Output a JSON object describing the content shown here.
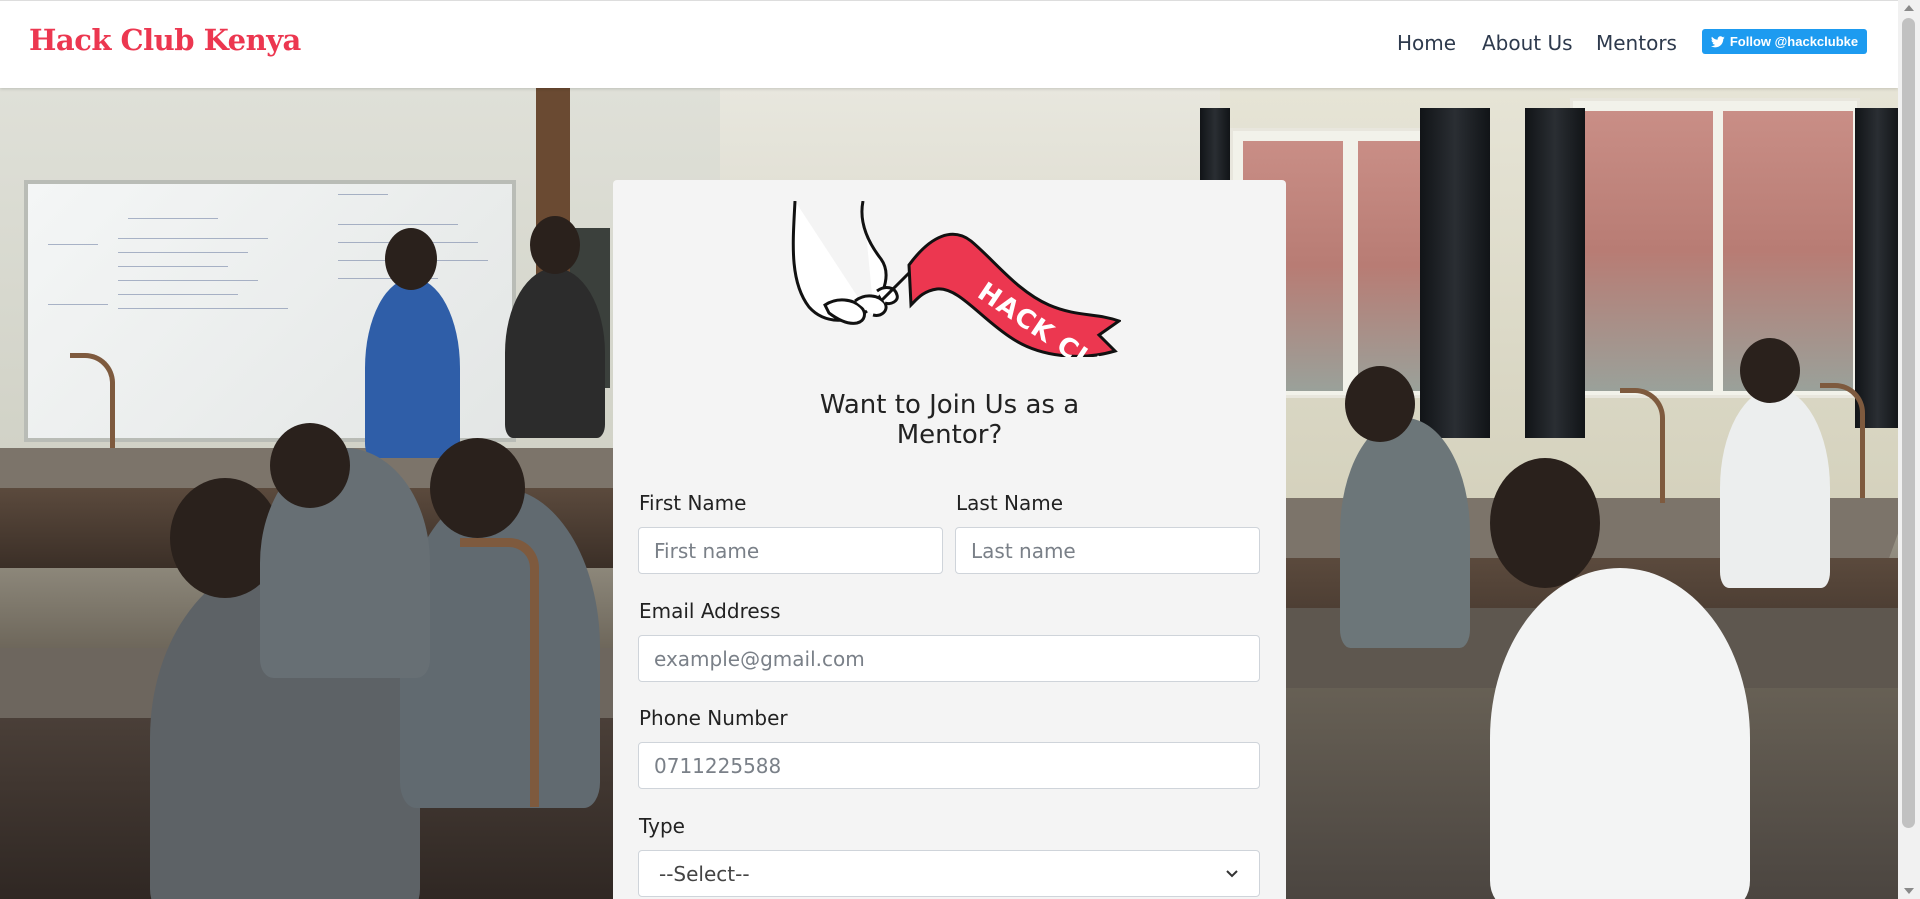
{
  "navbar": {
    "brand": "Hack Club Kenya",
    "links": [
      "Home",
      "About Us",
      "Mentors"
    ],
    "follow_label": "Follow @hackclubke"
  },
  "logo": {
    "flag_text": "HACK CLUB"
  },
  "form": {
    "title_line1": "Want to Join Us as a",
    "title_line2": "Mentor?",
    "first_name_label": "First Name",
    "first_name_placeholder": "First name",
    "last_name_label": "Last Name",
    "last_name_placeholder": "Last name",
    "email_label": "Email Address",
    "email_placeholder": "example@gmail.com",
    "phone_label": "Phone Number",
    "phone_placeholder": "0711225588",
    "type_label": "Type",
    "type_selected": "--Select--"
  },
  "colors": {
    "brand": "#ec3750",
    "twitter": "#1d9bf0",
    "card": "#f4f4f4"
  }
}
